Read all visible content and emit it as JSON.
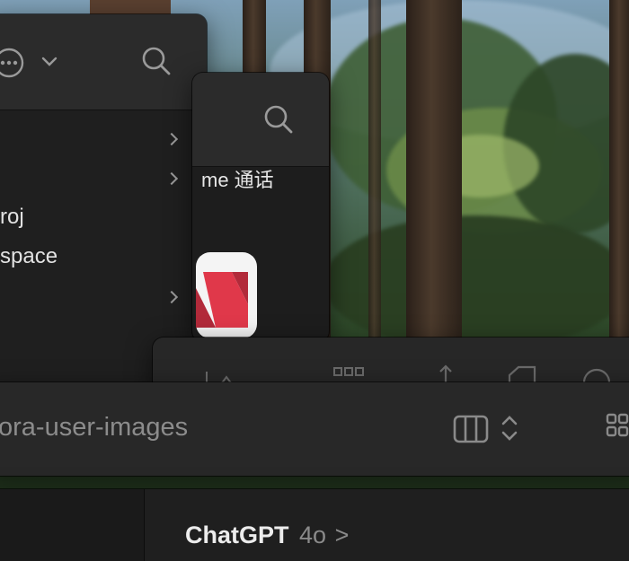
{
  "finder_window": {
    "sidebar_items": [
      {
        "label": "",
        "has_chevron": true
      },
      {
        "label": "",
        "has_chevron": true
      },
      {
        "label": "roj",
        "has_chevron": false
      },
      {
        "label": "space",
        "has_chevron": false
      },
      {
        "label": "",
        "has_chevron": true
      }
    ],
    "icons": [
      "more-options-icon",
      "chevron-down-icon",
      "search-icon"
    ]
  },
  "app_window": {
    "facetime_label": "me 通话",
    "app_icon": "news-app-icon",
    "icons": [
      "search-icon"
    ]
  },
  "wide_window": {
    "icons": [
      "grid-view-icon",
      "share-icon",
      "tag-icon",
      "more-icon"
    ]
  },
  "path_window": {
    "folder_name": "ora-user-images",
    "icons": [
      "column-view-icon",
      "sort-stepper-icon",
      "grid-view-icon"
    ]
  },
  "chat_window": {
    "app_name": "ChatGPT",
    "model": "4o",
    "chevron": ">"
  },
  "colors": {
    "window_bg": "#1f1f1f",
    "toolbar_bg": "#2b2b2b",
    "text_primary": "#e6e6e6",
    "text_secondary": "#8a8a8a",
    "news_red": "#e0384a"
  }
}
